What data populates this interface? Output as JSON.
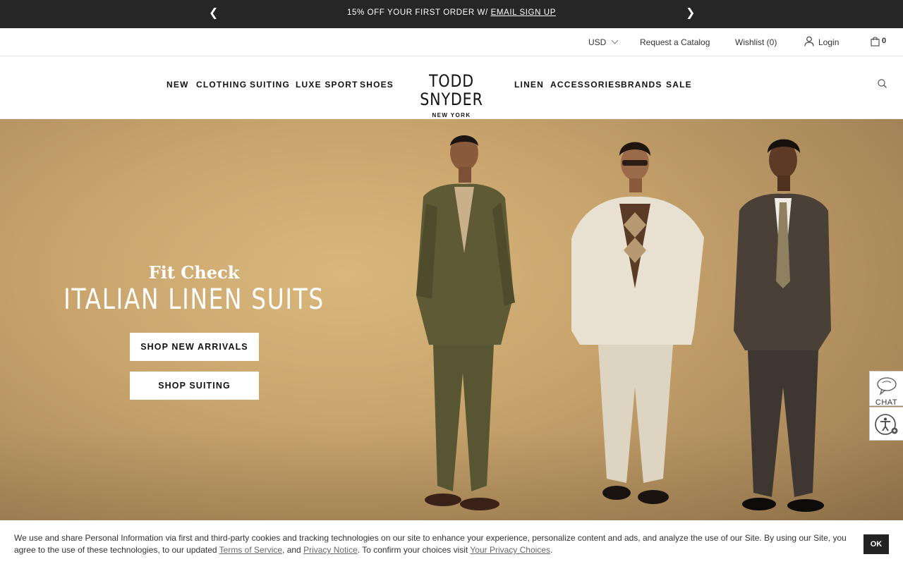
{
  "promo": {
    "prev_arrow": "❮",
    "next_arrow": "❯",
    "text": "15% OFF YOUR FIRST ORDER W/ ",
    "link": "EMAIL SIGN UP"
  },
  "utility": {
    "currency": "USD",
    "catalog": "Request a Catalog",
    "wishlist": "Wishlist (0)",
    "login": "Login",
    "bag_count": "0"
  },
  "nav": {
    "left": [
      "NEW",
      "CLOTHING",
      "SUITING",
      "LUXE SPORT",
      "SHOES"
    ],
    "right": [
      "LINEN",
      "ACCESSORIES",
      "BRANDS",
      "SALE"
    ]
  },
  "logo": {
    "main": "TODD SNYDER",
    "sub": "NEW YORK"
  },
  "hero": {
    "eyebrow": "Fit Check",
    "title": "ITALIAN LINEN SUITS",
    "button_new": "SHOP NEW ARRIVALS",
    "button_suiting": "SHOP SUITING"
  },
  "widgets": {
    "chat_label": "CHAT"
  },
  "cookie": {
    "text_1": "We use and share Personal Information via first and third-party cookies and tracking technologies on our site to enhance your experience, personalize content and ads, and analyze the use of our Site. By using our Site, you agree to the use of these technologies, to our updated ",
    "terms_link": "Terms of Service",
    "text_2": ", and ",
    "privacy_link": "Privacy Notice",
    "text_3": ". To confirm your choices visit ",
    "choices_link": "Your Privacy Choices",
    "text_4": ".",
    "ok_label": "OK"
  },
  "colors": {
    "promo_bg": "#262626",
    "hero_bg": "#c9a56d",
    "text_dark": "#111111"
  }
}
